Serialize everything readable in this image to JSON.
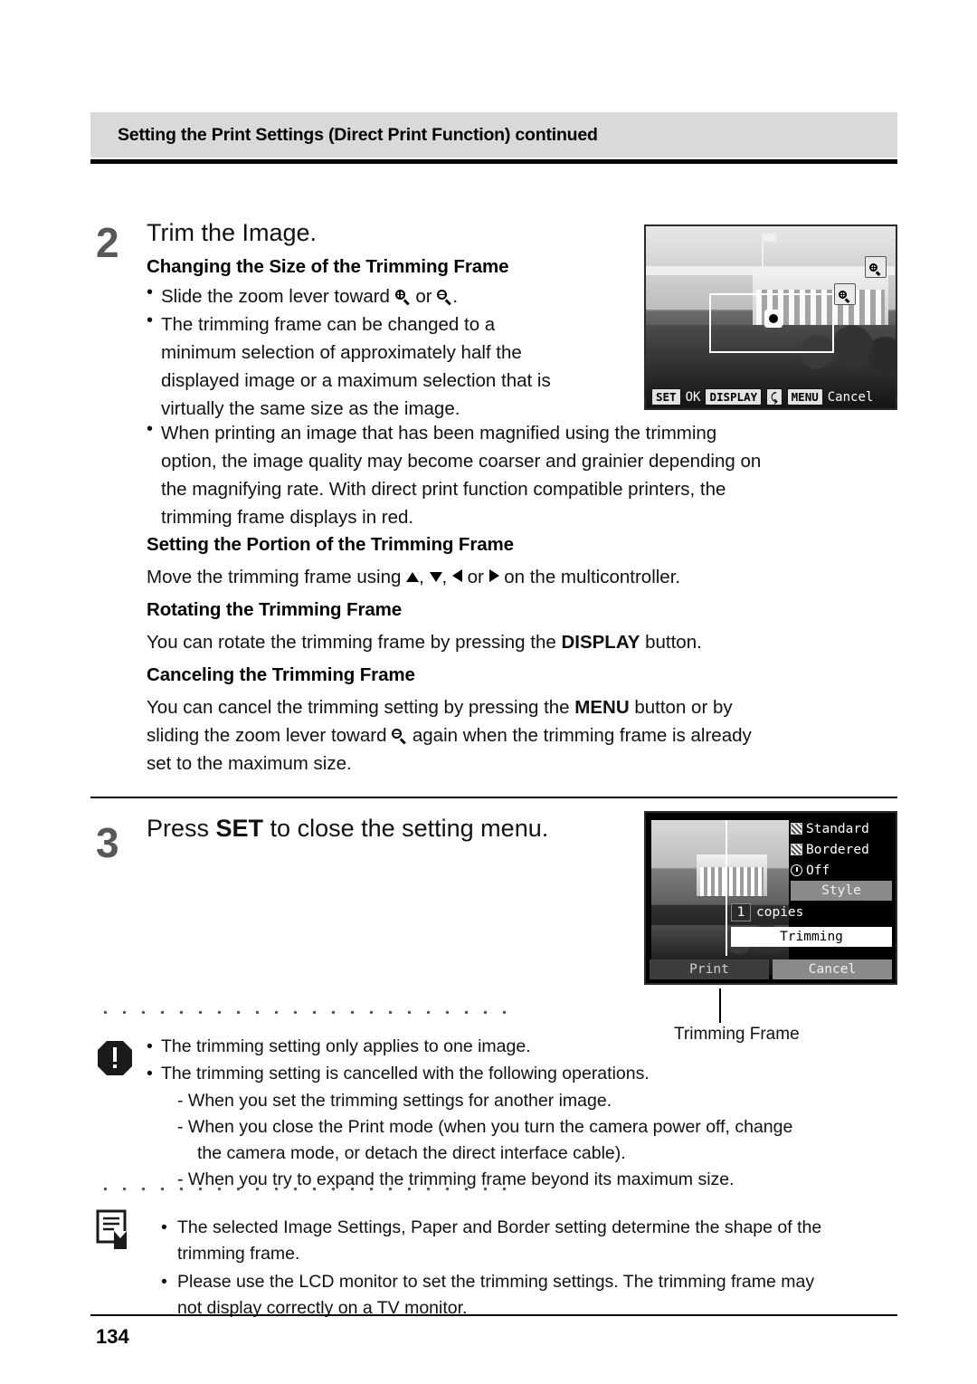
{
  "header": {
    "title": "Setting the Print Settings (Direct Print Function) continued"
  },
  "steps": [
    {
      "number": "2",
      "title": "Trim the Image.",
      "sections": [
        {
          "heading": "Changing the Size of the Trimming Frame",
          "bullets": [
            "Slide the zoom lever toward  or .",
            "The trimming frame can be changed to a minimum selection of approximately half the displayed image or a maximum selection that is virtually the same size as the image.",
            "When printing an image that has been magnified using the trimming option, the image quality may become coarser and grainier depending on the magnifying rate.  With direct print function compatible printers, the trimming frame displays in red."
          ]
        },
        {
          "heading": "Setting the Portion of the Trimming Frame",
          "body": "Move the trimming frame using  ,  ,  or  on the multicontroller."
        },
        {
          "heading": "Rotating the Trimming Frame",
          "body": "You can rotate the trimming frame by pressing the DISPLAY button."
        },
        {
          "heading": "Canceling the Trimming Frame",
          "body": "You can cancel the trimming setting by pressing the MENU button or by sliding the zoom lever toward  again when the trimming frame is already set to the maximum size."
        }
      ]
    },
    {
      "number": "3",
      "title_pre": "Press ",
      "title_key": "SET",
      "title_post": " to close the setting menu."
    }
  ],
  "body_lines": {
    "b1": "Slide the zoom lever toward",
    "b1_mid": "or",
    "b1_end": ".",
    "b2_l1": "The trimming frame can be changed to a",
    "b2_l2": "minimum selection of approximately half the",
    "b2_l3": "displayed image or a maximum selection that is",
    "b2_l4": "virtually the same size as the image.",
    "b3_l1": "When printing an image that has been magnified using the trimming",
    "b3_l2": "option, the image quality may become coarser and grainier depending on",
    "b3_l3": "the magnifying rate.  With direct print function compatible printers, the",
    "b3_l4": "trimming frame displays in red.",
    "portion_pre": "Move the trimming frame using ",
    "portion_mid1": ", ",
    "portion_mid2": ", ",
    "portion_mid3": " or ",
    "portion_post": " on the multicontroller.",
    "rotate_pre": "You can rotate the trimming frame by pressing the ",
    "rotate_key": "DISPLAY",
    "rotate_post": " button.",
    "cancel_l1_pre": "You can cancel the trimming setting by pressing the ",
    "cancel_l1_key": "MENU",
    "cancel_l1_post": " button or by",
    "cancel_l2_pre": "sliding the zoom lever toward ",
    "cancel_l2_post": " again when the trimming frame is already",
    "cancel_l3": "set to the maximum size."
  },
  "lcd_trim": {
    "buttons": [
      {
        "key": "SET",
        "label": "OK"
      },
      {
        "key": "DISPLAY",
        "label": ""
      },
      {
        "key": "MENU",
        "label": "Cancel"
      }
    ],
    "icon_magnify_in": "magnify-plus-icon",
    "icon_magnify_out": "magnify-minus-icon"
  },
  "lcd_menu": {
    "rows": [
      {
        "label": "Standard",
        "icon": "pattern-swatch-icon"
      },
      {
        "label": "Bordered",
        "icon": "pattern-swatch-icon"
      },
      {
        "label": "Off",
        "icon": "clock-icon"
      }
    ],
    "style_label": "Style",
    "copies_count": "1",
    "copies_label": "copies",
    "trimming_label": "Trimming",
    "print_label": "Print",
    "cancel_label": "Cancel"
  },
  "callout": {
    "label": "Trimming Frame"
  },
  "warning_notes": [
    "The trimming setting only applies to one image.",
    "The trimming setting is cancelled with the following operations.",
    "-  When you set the trimming settings for another image.",
    "-  When you close the Print mode (when you turn the camera power off, change",
    "the camera mode, or detach the direct interface cable).",
    "-  When you try to expand the trimming frame beyond its maximum size."
  ],
  "info_notes": [
    "The selected Image Settings, Paper and Border setting determine the shape of the",
    "trimming frame.",
    "Please use the LCD monitor to set the trimming settings. The trimming frame may",
    "not display correctly on a TV monitor."
  ],
  "page_number": "134"
}
